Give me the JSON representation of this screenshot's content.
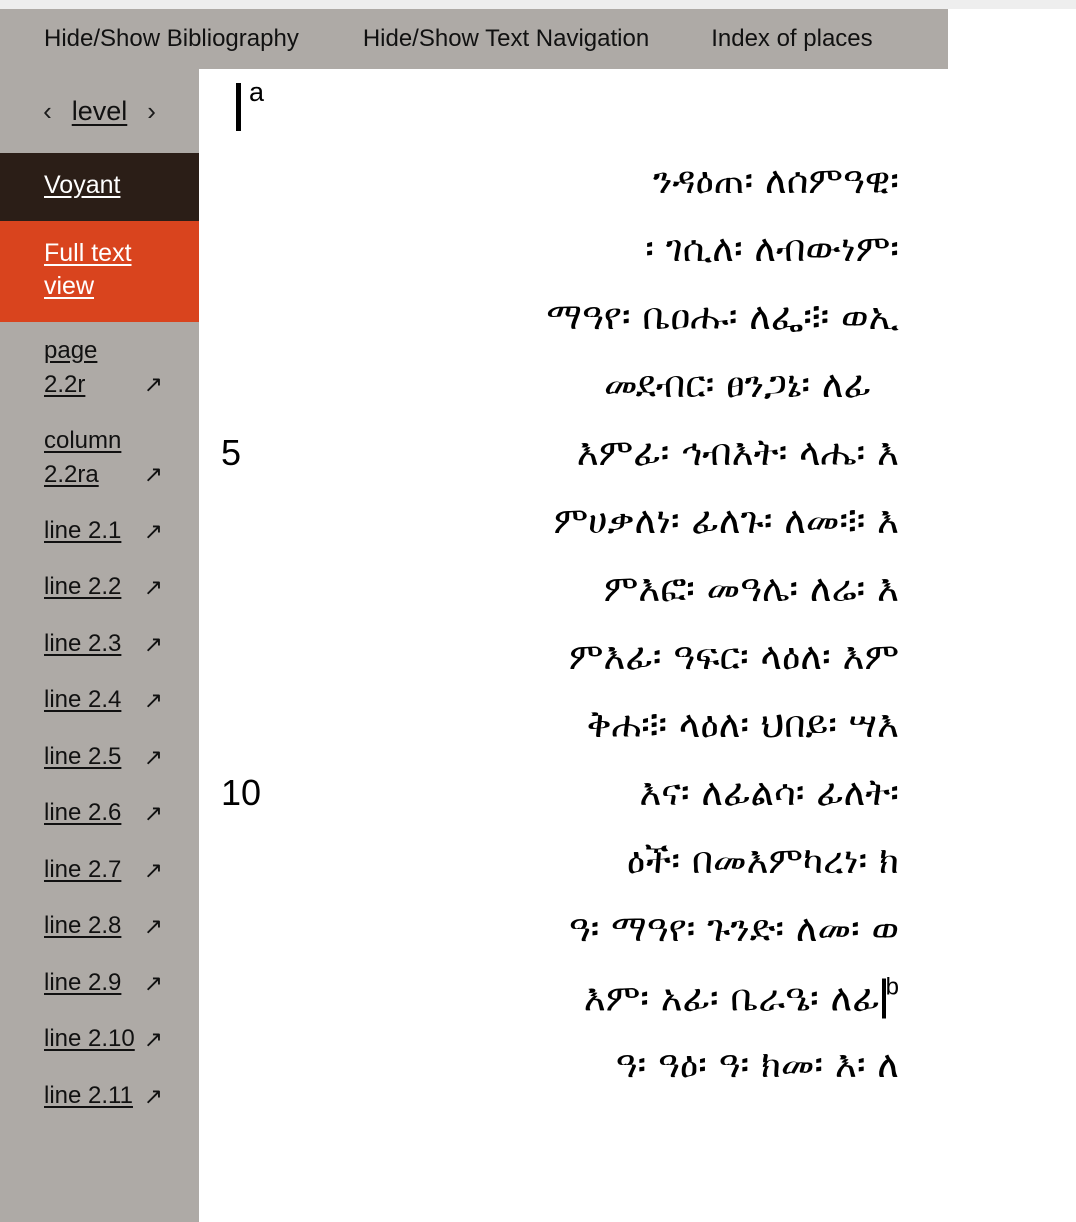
{
  "menubar": {
    "items": [
      {
        "label": "Hide/Show Bibliography"
      },
      {
        "label": "Hide/Show Text Navigation"
      },
      {
        "label": "Index of places"
      }
    ]
  },
  "sidebar": {
    "level_nav": {
      "prev_icon": "‹",
      "label": "level",
      "next_icon": "›"
    },
    "views": [
      {
        "name": "voyant",
        "label": "Voyant",
        "bg": "#2b1e17",
        "color": "#ffffff"
      },
      {
        "name": "full-text-view",
        "label": "Full text view",
        "bg": "#d9441e",
        "color": "#ffffff"
      }
    ],
    "locations": [
      {
        "label": "page 2.2r",
        "arrow": "↗"
      },
      {
        "label": "column 2.2ra",
        "arrow": "↗"
      },
      {
        "label": "line 2.1",
        "arrow": "↗"
      },
      {
        "label": "line 2.2",
        "arrow": "↗"
      },
      {
        "label": "line 2.3",
        "arrow": "↗"
      },
      {
        "label": "line 2.4",
        "arrow": "↗"
      },
      {
        "label": "line 2.5",
        "arrow": "↗"
      },
      {
        "label": "line 2.6",
        "arrow": "↗"
      },
      {
        "label": "line 2.7",
        "arrow": "↗"
      },
      {
        "label": "line 2.8",
        "arrow": "↗"
      },
      {
        "label": "line 2.9",
        "arrow": "↗"
      },
      {
        "label": "line 2.10",
        "arrow": "↗"
      },
      {
        "label": "line 2.11",
        "arrow": "↗"
      }
    ]
  },
  "text": {
    "folio_marker": {
      "sup": "a"
    },
    "column_end_marker": {
      "sup": "b"
    },
    "lines": [
      {
        "num": "",
        "text": "ንዳዕጠ፡ ለሰምዓዊ፡"
      },
      {
        "num": "",
        "text": "፡ ገሲለ፡ ለብውነም፡"
      },
      {
        "num": "",
        "text": "ማዓየ፡ ቤዐሑ፡ ለፌ፨ ወኢ"
      },
      {
        "num": "",
        "text": "መደብር፡ ፀንጋኔ፡ ለፊ"
      },
      {
        "num": "5",
        "text": "እምፊ፡ ኅብእት፡ ላሔ፡ እ"
      },
      {
        "num": "",
        "text": "ምሀቃለነ፡ ፊለጉ፡ ለመ፨ እ"
      },
      {
        "num": "",
        "text": "ምእፎ፡ መዓሌ፡ ለሬ፡ እ"
      },
      {
        "num": "",
        "text": "ምእፊ፡ ዓፍር፡ ላዕለ፡ እም"
      },
      {
        "num": "",
        "text": "ቅሐ፨ ላዕለ፡ ህበይ፡ ሣእ"
      },
      {
        "num": "10",
        "text": "እና፡ ለፊልሳ፡ ፊለት፡"
      },
      {
        "num": "",
        "text": "ዕች፡ በመእምካረነ፡ ክ"
      },
      {
        "num": "",
        "text": "ዓ፡ ማዓየ፡ ጉንድ፡ ለመ፡ ወ"
      },
      {
        "num": "",
        "text": "እም፡ አፊ፡ ቤራዔ፡ ለፊ"
      },
      {
        "num": "",
        "text": "ዓ፡ ዓዕ፡ ዓ፡ ክመ፡ እ፡ ለ"
      }
    ]
  }
}
